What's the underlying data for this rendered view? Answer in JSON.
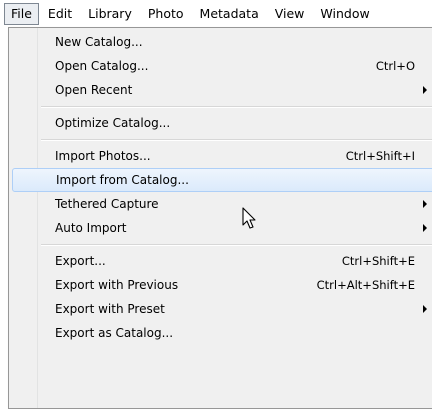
{
  "menubar": {
    "items": [
      {
        "label": "File",
        "open": true
      },
      {
        "label": "Edit"
      },
      {
        "label": "Library"
      },
      {
        "label": "Photo"
      },
      {
        "label": "Metadata"
      },
      {
        "label": "View"
      },
      {
        "label": "Window"
      }
    ]
  },
  "file_menu": {
    "groups": [
      [
        {
          "label": "New Catalog...",
          "shortcut": ""
        },
        {
          "label": "Open Catalog...",
          "shortcut": "Ctrl+O"
        },
        {
          "label": "Open Recent",
          "shortcut": "",
          "submenu": true
        }
      ],
      [
        {
          "label": "Optimize Catalog...",
          "shortcut": ""
        }
      ],
      [
        {
          "label": "Import Photos...",
          "shortcut": "Ctrl+Shift+I"
        },
        {
          "label": "Import from Catalog...",
          "shortcut": "",
          "highlighted": true
        },
        {
          "label": "Tethered Capture",
          "shortcut": "",
          "submenu": true
        },
        {
          "label": "Auto Import",
          "shortcut": "",
          "submenu": true
        }
      ],
      [
        {
          "label": "Export...",
          "shortcut": "Ctrl+Shift+E"
        },
        {
          "label": "Export with Previous",
          "shortcut": "Ctrl+Alt+Shift+E"
        },
        {
          "label": "Export with Preset",
          "shortcut": "",
          "submenu": true
        },
        {
          "label": "Export as Catalog...",
          "shortcut": ""
        }
      ]
    ]
  },
  "colors": {
    "menu_background": "#f0f0f0",
    "highlight_top": "#eef5fd",
    "highlight_bottom": "#dbeafb",
    "highlight_border": "#aecff7",
    "open_menu_border": "#7e8792"
  },
  "cursor": {
    "icon": "arrow-cursor-icon"
  }
}
